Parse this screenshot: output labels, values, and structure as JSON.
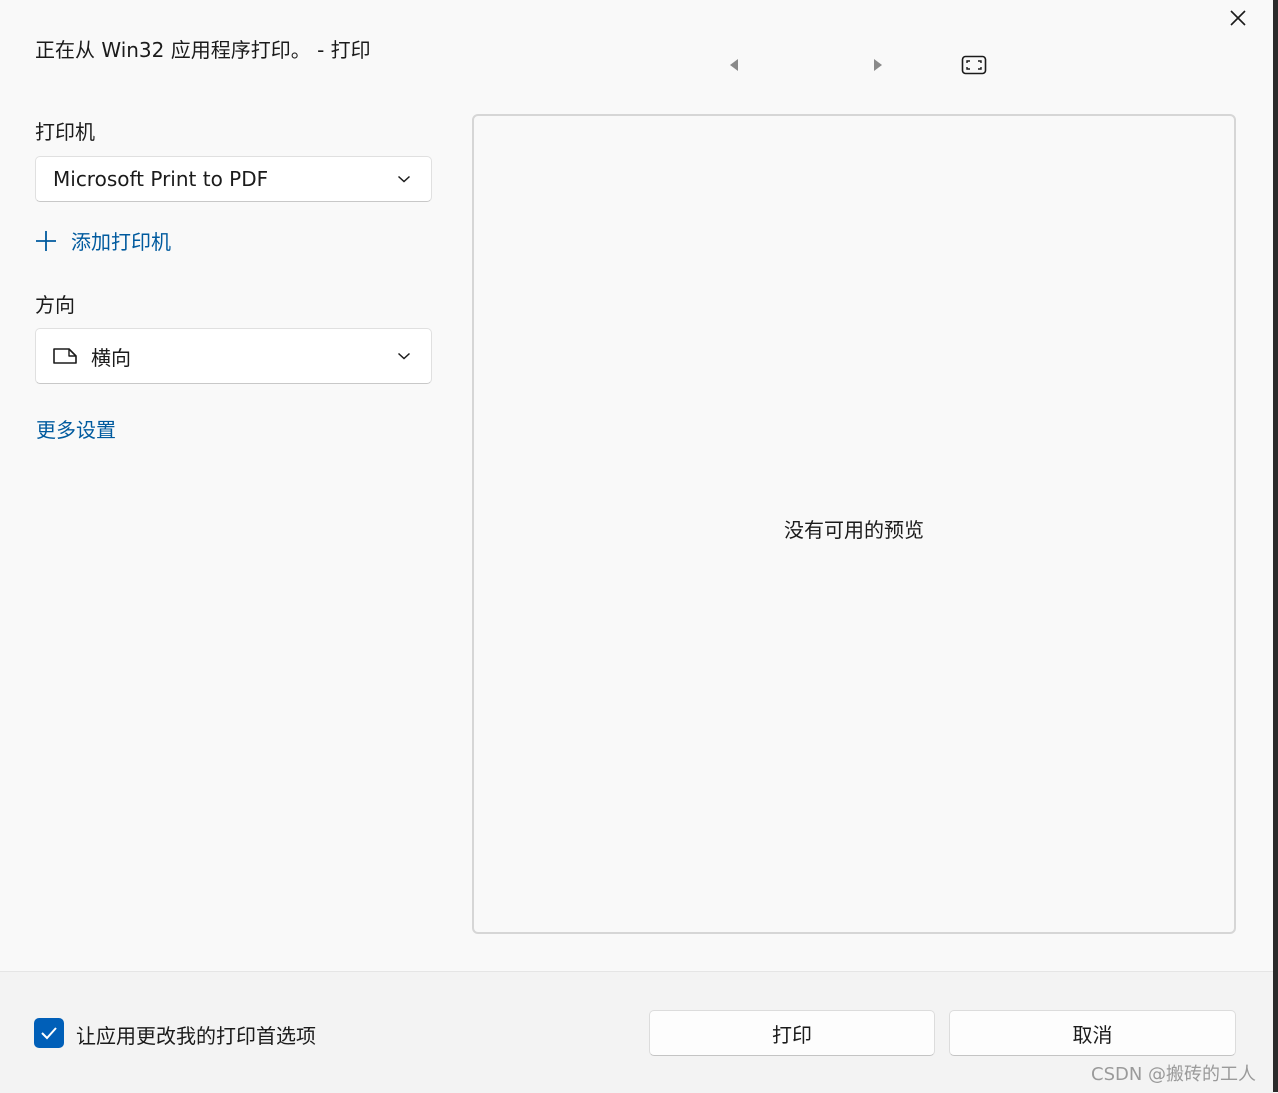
{
  "window": {
    "title": "正在从 Win32 应用程序打印。 - 打印",
    "close_icon": "close-icon"
  },
  "preview_nav": {
    "prev_icon": "triangle-left-icon",
    "next_icon": "triangle-right-icon",
    "fit_icon": "fit-to-window-icon"
  },
  "printer": {
    "label": "打印机",
    "selected": "Microsoft Print to PDF",
    "add_printer_label": "添加打印机"
  },
  "orientation": {
    "label": "方向",
    "selected": "横向",
    "icon": "landscape-page-icon"
  },
  "more_settings_label": "更多设置",
  "preview": {
    "message": "没有可用的预览"
  },
  "footer": {
    "checkbox_label": "让应用更改我的打印首选项",
    "checkbox_checked": true,
    "print_label": "打印",
    "cancel_label": "取消"
  },
  "watermark": "CSDN @搬砖的工人",
  "colors": {
    "accent": "#005fb8",
    "link": "#005a9e",
    "background": "#f9f9f9",
    "footer": "#f3f3f3"
  }
}
